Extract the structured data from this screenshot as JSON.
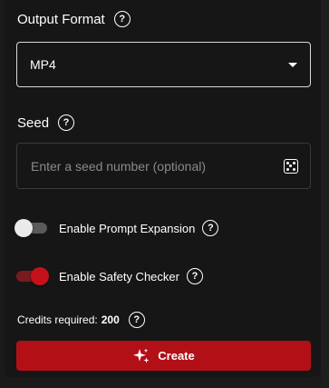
{
  "output_format": {
    "label": "Output Format",
    "selected": "MP4"
  },
  "seed": {
    "label": "Seed",
    "placeholder": "Enter a seed number (optional)",
    "value": ""
  },
  "prompt_expansion": {
    "label": "Enable Prompt Expansion",
    "enabled": false
  },
  "safety_checker": {
    "label": "Enable Safety Checker",
    "enabled": true
  },
  "credits": {
    "label": "Credits required:",
    "amount": "200"
  },
  "create_button": {
    "label": "Create"
  },
  "colors": {
    "accent": "#b30f17",
    "background": "#161616"
  }
}
